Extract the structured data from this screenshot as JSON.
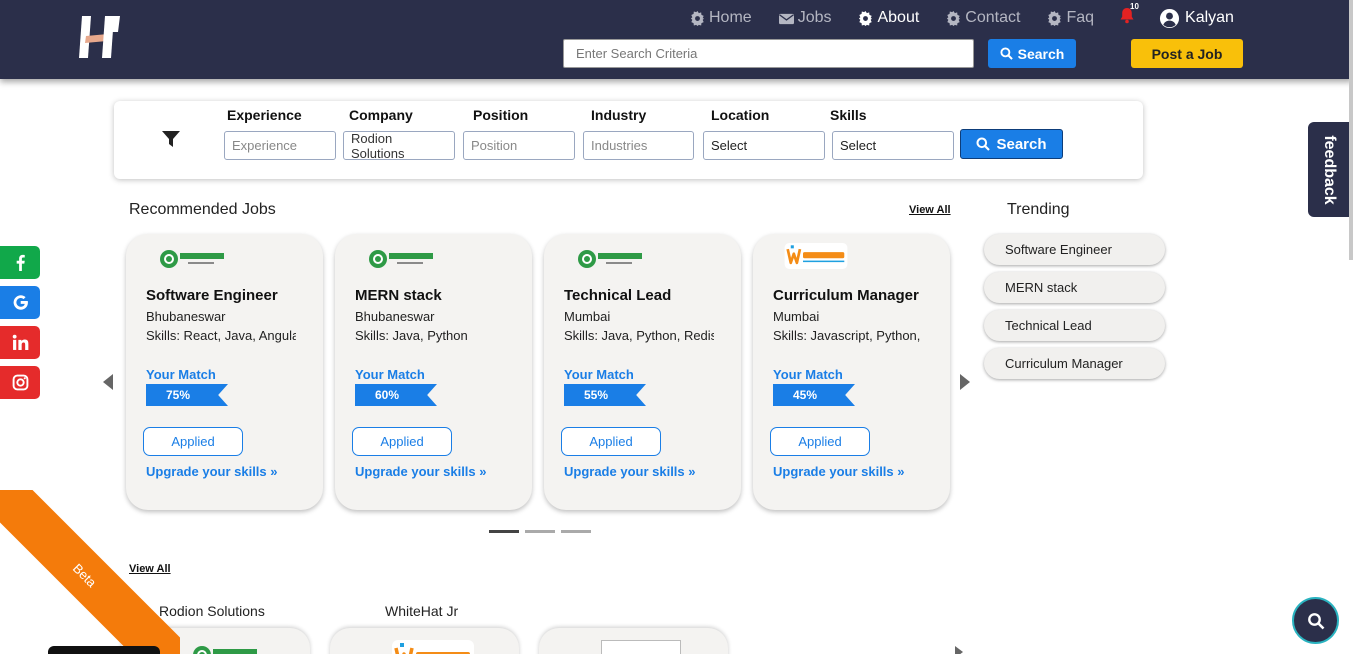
{
  "header": {
    "nav": [
      {
        "label": "Home",
        "icon": "gear-icon"
      },
      {
        "label": "Jobs",
        "icon": "envelope-icon"
      },
      {
        "label": "About",
        "icon": "gear-icon"
      },
      {
        "label": "Contact",
        "icon": "gear-icon"
      },
      {
        "label": "Faq",
        "icon": "gear-icon"
      }
    ],
    "notification_count": "10",
    "user_name": "Kalyan",
    "search_placeholder": "Enter Search Criteria",
    "search_button": "Search",
    "post_job_button": "Post a Job"
  },
  "filters": {
    "labels": {
      "experience": "Experience",
      "company": "Company",
      "position": "Position",
      "industry": "Industry",
      "location": "Location",
      "skills": "Skills"
    },
    "values": {
      "experience": "Experience",
      "company": "Rodion Solutions",
      "position": "Position",
      "industry": "Industries",
      "location": "Select",
      "skills": "Select"
    },
    "search_button": "Search"
  },
  "recommended": {
    "title": "Recommended Jobs",
    "view_all": "View All",
    "match_label": "Your Match",
    "applied_label": "Applied",
    "upgrade_label": "Upgrade your skills »",
    "jobs": [
      {
        "title": "Software Engineer",
        "location": "Bhubaneswar",
        "skills": "Skills: React, Java, Angula",
        "match": "75%",
        "logo": "rodion-logo"
      },
      {
        "title": "MERN stack",
        "location": "Bhubaneswar",
        "skills": "Skills: Java, Python",
        "match": "60%",
        "logo": "rodion-logo"
      },
      {
        "title": "Technical Lead",
        "location": "Mumbai",
        "skills": "Skills: Java, Python, Redis",
        "match": "55%",
        "logo": "rodion-logo"
      },
      {
        "title": "Curriculum Manager",
        "location": "Mumbai",
        "skills": "Skills: Javascript, Python,",
        "match": "45%",
        "logo": "whitehat-logo"
      }
    ]
  },
  "trending": {
    "title": "Trending",
    "items": [
      "Software Engineer",
      "MERN stack",
      "Technical Lead",
      "Curriculum Manager"
    ]
  },
  "feedback_label": "feedback",
  "companies": {
    "view_all": "View All",
    "names": [
      "Rodion Solutions",
      "WhiteHat Jr"
    ]
  },
  "ribbon_label": "Beta",
  "colors": {
    "header_bg": "#2b2f4a",
    "primary": "#1a7ee6",
    "accent_yellow": "#f9c00a",
    "ribbon": "#f47b0b",
    "facebook": "#11a84a",
    "google": "#1a7ee6",
    "linkedin": "#e52b2b",
    "instagram": "#e52b2b"
  }
}
